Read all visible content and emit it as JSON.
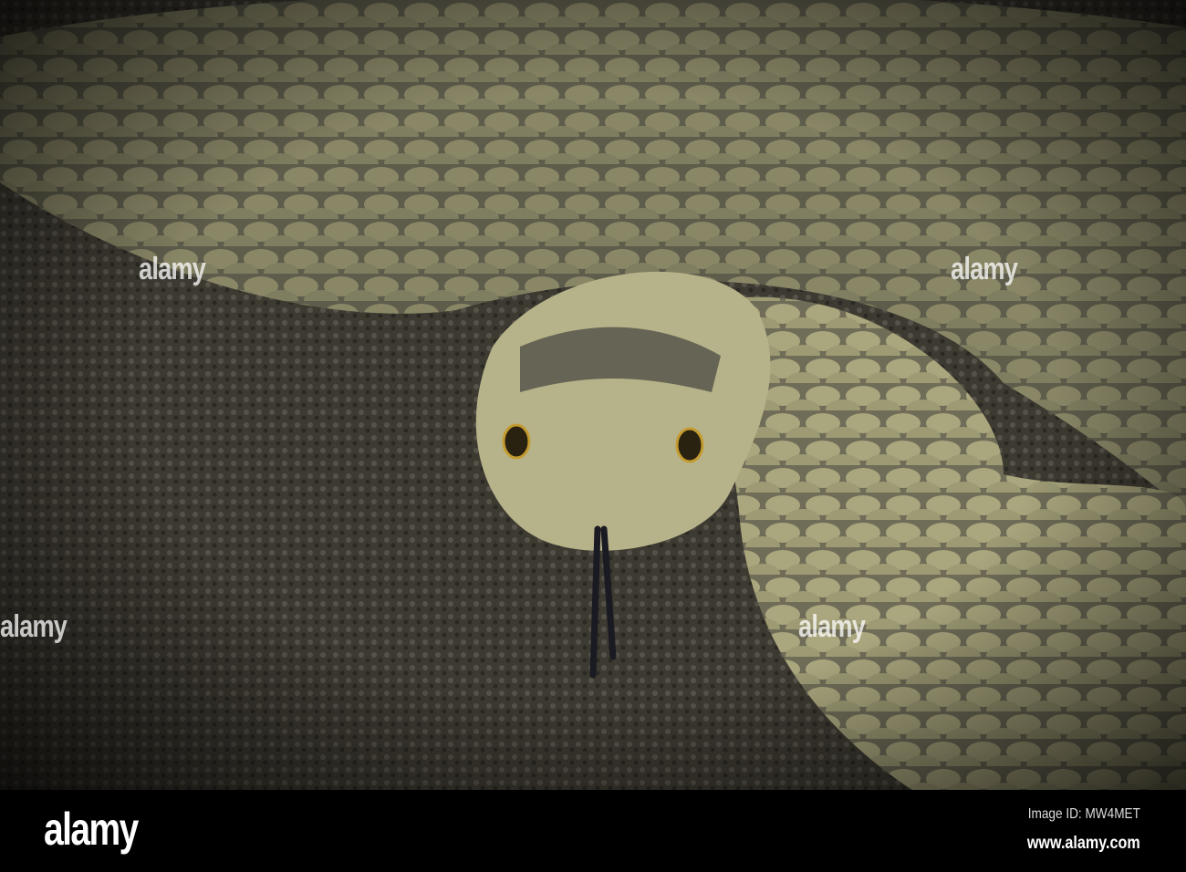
{
  "photo": {
    "subject": "coiled snake with forked tongue on soil",
    "watermark_text": "alamy"
  },
  "footer": {
    "logo": "alamy",
    "image_id": "Image ID: MW4MET",
    "website": "www.alamy.com"
  },
  "colors": {
    "soil": "#3b382f",
    "scales_light": "#b8b48a",
    "scales_dark": "#4a4a44",
    "footer_bg": "#000000"
  }
}
